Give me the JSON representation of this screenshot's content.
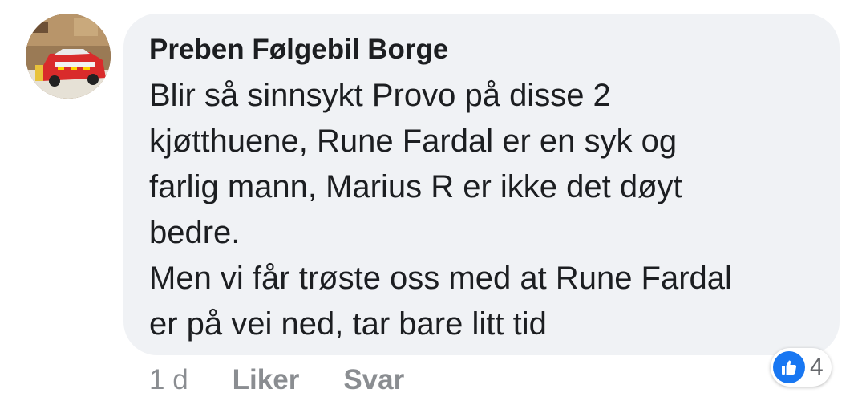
{
  "comment": {
    "author": "Preben Følgebil Borge",
    "lines": [
      "Blir så sinnsykt Provo på disse 2",
      "kjøtthuene, Rune Fardal er en syk og",
      "farlig mann, Marius R er ikke det døyt",
      "bedre.",
      "Men vi får trøste oss med at Rune Fardal",
      "er på vei ned, tar bare litt tid"
    ]
  },
  "actions": {
    "timestamp": "1 d",
    "like_label": "Liker",
    "reply_label": "Svar"
  },
  "reactions": {
    "icon": "thumbs-up-icon",
    "count": "4",
    "color": "#1877f2"
  },
  "colors": {
    "bubble": "#f0f2f5",
    "text": "#1c1e21",
    "muted": "#8a8d91"
  }
}
